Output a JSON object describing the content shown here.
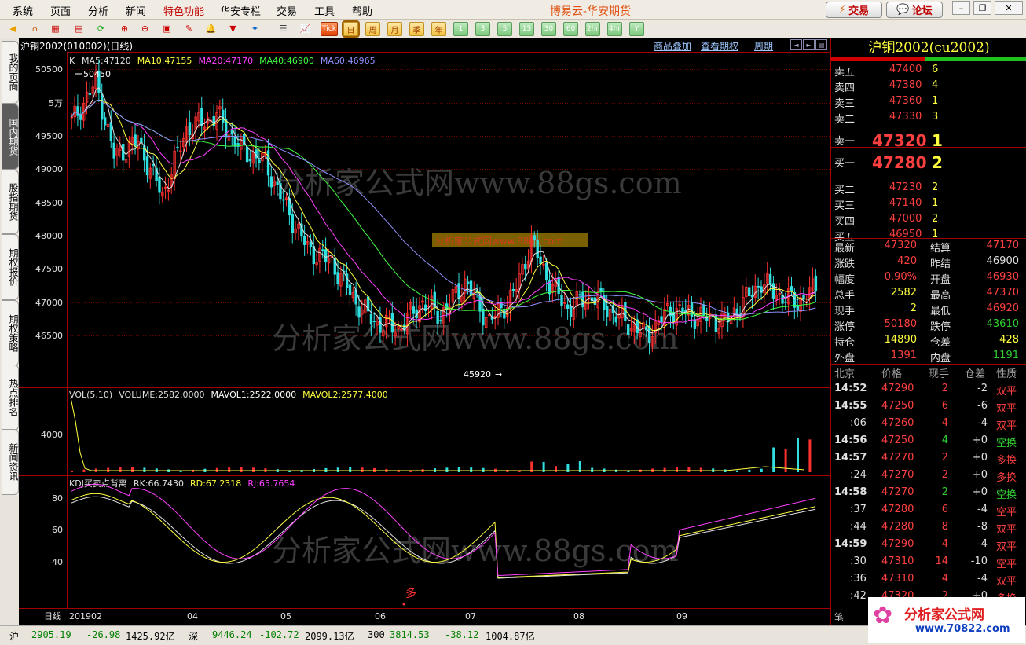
{
  "menu": {
    "items": [
      "系统",
      "页面",
      "分析",
      "新闻",
      "特色功能",
      "华安专栏",
      "交易",
      "工具",
      "帮助"
    ],
    "app_title": "博易云-华安期货",
    "trade_btn": "交易",
    "forum_btn": "论坛"
  },
  "toolbar": {
    "tick_label": "Tick",
    "periods": [
      "日",
      "周",
      "月",
      "季",
      "年",
      "1",
      "3",
      "5",
      "15",
      "30",
      "60",
      "2hr",
      "4hr",
      "Y"
    ],
    "selected_period": "日"
  },
  "left_tabs": [
    "我的页面",
    "国内期货",
    "股指期货",
    "期权报价",
    "期权策略",
    "热点排名",
    "新闻资讯"
  ],
  "chart": {
    "title": "沪铜2002(010002)(日线)",
    "links": [
      "商品叠加",
      "查看期权",
      "周期"
    ],
    "main_indicator": {
      "label": "K",
      "items": [
        {
          "text": "MA5:47120",
          "color": "#e0e0e0"
        },
        {
          "text": "MA10:47155",
          "color": "#ffff40"
        },
        {
          "text": "MA20:47170",
          "color": "#ff40ff"
        },
        {
          "text": "MA40:46900",
          "color": "#40ff40"
        },
        {
          "text": "MA60:46965",
          "color": "#9090ff"
        }
      ]
    },
    "y_labels": [
      "50500",
      "5万",
      "49500",
      "49000",
      "48500",
      "48000",
      "47500",
      "47000",
      "46500"
    ],
    "high_marker": "50450",
    "low_marker": "45920",
    "vol_indicator": [
      {
        "text": "VOL(5,10)",
        "color": "#e0e0e0"
      },
      {
        "text": "VOLUME:2582.0000",
        "color": "#e0e0e0"
      },
      {
        "text": "MAVOL1:2522.0000",
        "color": "#ffffff"
      },
      {
        "text": "MAVOL2:2577.4000",
        "color": "#ffff40"
      }
    ],
    "vol_y_label": "4000",
    "kdj_indicator": [
      {
        "text": "KDJ买卖点背离",
        "color": "#e0e0e0"
      },
      {
        "text": "RK:66.7430",
        "color": "#e0e0e0"
      },
      {
        "text": "RD:67.2318",
        "color": "#ffff40"
      },
      {
        "text": "RJ:65.7654",
        "color": "#ff40ff"
      }
    ],
    "kdj_y_labels": [
      "80",
      "60",
      "40"
    ],
    "kdj_signal": "多",
    "period_label": "日线",
    "x_labels": [
      "201902",
      "04",
      "05",
      "06",
      "07",
      "08",
      "09"
    ],
    "watermark": "分析家公式网www.88gs.com",
    "watermark_small": "分析家公式网www.88gs.com"
  },
  "quote": {
    "title": "沪铜2002(cu2002)",
    "sells": [
      {
        "label": "卖五",
        "price": "47400",
        "vol": "6"
      },
      {
        "label": "卖四",
        "price": "47380",
        "vol": "4"
      },
      {
        "label": "卖三",
        "price": "47360",
        "vol": "1"
      },
      {
        "label": "卖二",
        "price": "47330",
        "vol": "3"
      },
      {
        "label": "卖一",
        "price": "47320",
        "vol": "1"
      }
    ],
    "buys": [
      {
        "label": "买一",
        "price": "47280",
        "vol": "2"
      },
      {
        "label": "买二",
        "price": "47230",
        "vol": "2"
      },
      {
        "label": "买三",
        "price": "47140",
        "vol": "1"
      },
      {
        "label": "买四",
        "price": "47000",
        "vol": "2"
      },
      {
        "label": "买五",
        "price": "46950",
        "vol": "1"
      }
    ],
    "stats": [
      {
        "l1": "最新",
        "v1": "47320",
        "c1": "red",
        "l2": "结算",
        "v2": "47170",
        "c2": "red"
      },
      {
        "l1": "涨跌",
        "v1": "420",
        "c1": "red",
        "l2": "昨结",
        "v2": "46900",
        "c2": "wht"
      },
      {
        "l1": "幅度",
        "v1": "0.90%",
        "c1": "red",
        "l2": "开盘",
        "v2": "46930",
        "c2": "red"
      },
      {
        "l1": "总手",
        "v1": "2582",
        "c1": "yel",
        "l2": "最高",
        "v2": "47370",
        "c2": "red"
      },
      {
        "l1": "现手",
        "v1": "2",
        "c1": "yel",
        "l2": "最低",
        "v2": "46920",
        "c2": "red"
      },
      {
        "l1": "涨停",
        "v1": "50180",
        "c1": "red",
        "l2": "跌停",
        "v2": "43610",
        "c2": "grn"
      },
      {
        "l1": "持仓",
        "v1": "14890",
        "c1": "yel",
        "l2": "仓差",
        "v2": "428",
        "c2": "yel"
      },
      {
        "l1": "外盘",
        "v1": "1391",
        "c1": "red",
        "l2": "内盘",
        "v2": "1191",
        "c2": "grn"
      }
    ],
    "tick_headers": [
      "北京",
      "价格",
      "现手",
      "仓差",
      "性质"
    ],
    "ticks": [
      {
        "time": "14:52",
        "price": "47290",
        "vol": "2",
        "oi": "-2",
        "type": "双平",
        "tc": "red"
      },
      {
        "time": "14:55",
        "price": "47250",
        "vol": "6",
        "oi": "-6",
        "type": "双平",
        "tc": "red"
      },
      {
        "time": ":06",
        "price": "47260",
        "vol": "4",
        "oi": "-4",
        "type": "双平",
        "tc": "red"
      },
      {
        "time": "14:56",
        "price": "47250",
        "vol": "4",
        "oi": "+0",
        "type": "空换",
        "tc": "grn"
      },
      {
        "time": "14:57",
        "price": "47270",
        "vol": "2",
        "oi": "+0",
        "type": "多换",
        "tc": "red"
      },
      {
        "time": ":24",
        "price": "47270",
        "vol": "2",
        "oi": "+0",
        "type": "多换",
        "tc": "red"
      },
      {
        "time": "14:58",
        "price": "47270",
        "vol": "2",
        "oi": "+0",
        "type": "空换",
        "tc": "grn"
      },
      {
        "time": ":37",
        "price": "47280",
        "vol": "6",
        "oi": "-4",
        "type": "空平",
        "tc": "red"
      },
      {
        "time": ":44",
        "price": "47280",
        "vol": "8",
        "oi": "-8",
        "type": "双平",
        "tc": "red"
      },
      {
        "time": "14:59",
        "price": "47290",
        "vol": "4",
        "oi": "-4",
        "type": "双平",
        "tc": "red"
      },
      {
        "time": ":30",
        "price": "47310",
        "vol": "14",
        "oi": "-10",
        "type": "空平",
        "tc": "red"
      },
      {
        "time": ":36",
        "price": "47310",
        "vol": "4",
        "oi": "-4",
        "type": "双平",
        "tc": "red"
      },
      {
        "time": ":42",
        "price": "47320",
        "vol": "2",
        "oi": "+0",
        "type": "多换",
        "tc": "red"
      }
    ],
    "bottom_tab": "笔"
  },
  "status": {
    "sh_label": "沪",
    "sh_index": "2905.19",
    "sh_chg": "-26.98",
    "sh_amt": "1425.92亿",
    "sz_label": "深",
    "sz_index": "9446.24",
    "sz_chg": "-102.72",
    "sz_amt": "2099.13亿",
    "c300_label": "300",
    "c300_index": "3814.53",
    "c300_chg": "-38.12",
    "c300_amt": "1004.87亿"
  },
  "logo": {
    "text": "分析家公式网",
    "url": "www.70822.com"
  }
}
